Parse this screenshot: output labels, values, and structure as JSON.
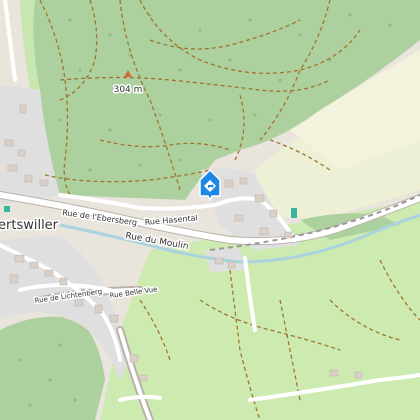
{
  "map": {
    "labels": {
      "elevation": "304 m",
      "town": "ertswiller",
      "street_ebersberg": "Rue de l'Ebersberg",
      "street_hasental": "Rue Hasental",
      "street_moulin": "Rue du Moulin",
      "street_belle_vue": "Rue Belle Vue",
      "street_lichtenberg": "Rue de Lichtenberg"
    },
    "marker": {
      "icon": "direction-sign-icon",
      "color": "#1e88e5"
    },
    "colors": {
      "forest": "#add19e",
      "meadow": "#cdebb0",
      "farmland": "#eef0d5",
      "residential": "#e0dfdf",
      "water": "#aad3df",
      "road": "#ffffff",
      "track": "#a0742c"
    }
  }
}
